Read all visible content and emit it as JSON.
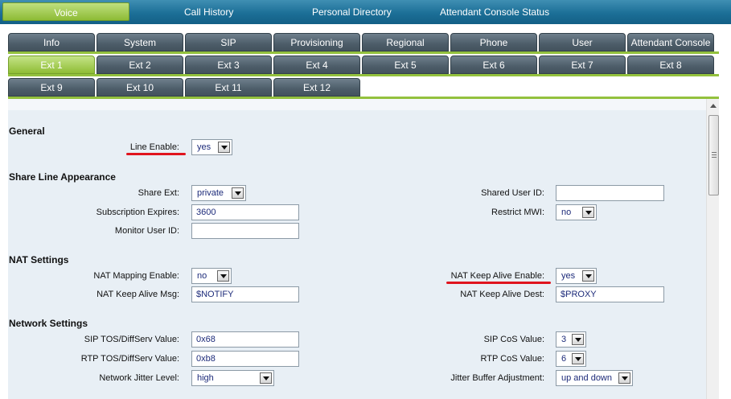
{
  "top_nav": [
    {
      "label": "Voice",
      "active": true
    },
    {
      "label": "Call History"
    },
    {
      "label": "Personal Directory"
    },
    {
      "label": "Attendant Console Status"
    }
  ],
  "tabs": [
    "Info",
    "System",
    "SIP",
    "Provisioning",
    "Regional",
    "Phone",
    "User",
    "Attendant Console"
  ],
  "ext_tabs_row1": [
    "Ext 1",
    "Ext 2",
    "Ext 3",
    "Ext 4",
    "Ext 5",
    "Ext 6",
    "Ext 7",
    "Ext 8"
  ],
  "ext_tabs_row2": [
    "Ext 9",
    "Ext 10",
    "Ext 11",
    "Ext 12"
  ],
  "active_ext": "Ext 1",
  "sections": {
    "general": "General",
    "share_line": "Share Line Appearance",
    "nat": "NAT Settings",
    "network": "Network Settings"
  },
  "fields": {
    "line_enable": {
      "label": "Line Enable:",
      "value": "yes"
    },
    "share_ext": {
      "label": "Share Ext:",
      "value": "private"
    },
    "shared_user_id": {
      "label": "Shared User ID:",
      "value": ""
    },
    "subscription_expires": {
      "label": "Subscription Expires:",
      "value": "3600"
    },
    "restrict_mwi": {
      "label": "Restrict MWI:",
      "value": "no"
    },
    "monitor_user_id": {
      "label": "Monitor User ID:",
      "value": ""
    },
    "nat_mapping_enable": {
      "label": "NAT Mapping Enable:",
      "value": "no"
    },
    "nat_keep_alive_enable": {
      "label": "NAT Keep Alive Enable:",
      "value": "yes"
    },
    "nat_keep_alive_msg": {
      "label": "NAT Keep Alive Msg:",
      "value": "$NOTIFY"
    },
    "nat_keep_alive_dest": {
      "label": "NAT Keep Alive Dest:",
      "value": "$PROXY"
    },
    "sip_tos": {
      "label": "SIP TOS/DiffServ Value:",
      "value": "0x68"
    },
    "sip_cos": {
      "label": "SIP CoS Value:",
      "value": "3"
    },
    "rtp_tos": {
      "label": "RTP TOS/DiffServ Value:",
      "value": "0xb8"
    },
    "rtp_cos": {
      "label": "RTP CoS Value:",
      "value": "6"
    },
    "network_jitter_level": {
      "label": "Network Jitter Level:",
      "value": "high"
    },
    "jitter_buffer_adjustment": {
      "label": "Jitter Buffer Adjustment:",
      "value": "up and down"
    }
  },
  "colors": {
    "nav_bar": "#1c6f97",
    "active_tab": "#8fbd35",
    "inactive_tab": "#4d5d69",
    "panel_bg": "#e8eff5",
    "highlight_underline": "#e0141e"
  }
}
